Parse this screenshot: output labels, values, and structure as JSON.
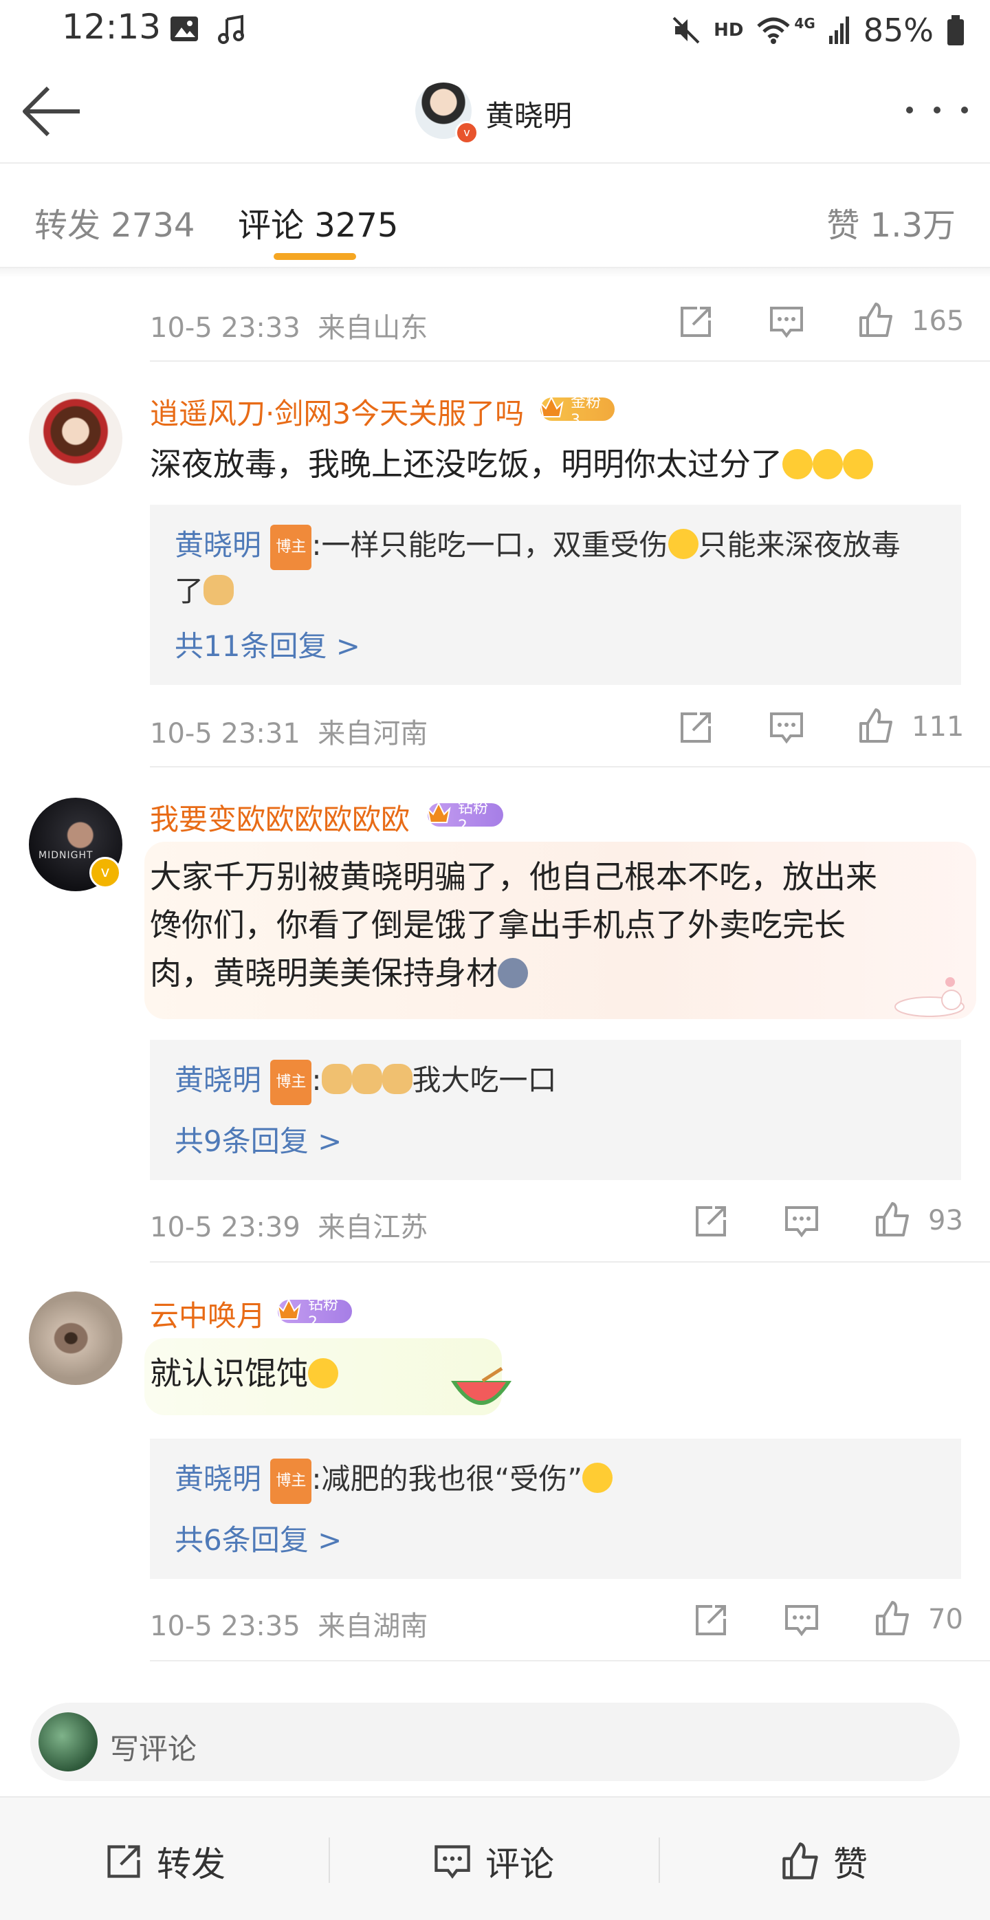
{
  "status_bar": {
    "time": "12:13",
    "network": "HD",
    "signal": "4G",
    "battery": "85%",
    "icons": [
      "gallery-icon",
      "music-icon",
      "mute-icon",
      "wifi-icon",
      "signal-icon",
      "battery-icon"
    ]
  },
  "header": {
    "title": "黄晓明",
    "back_icon": "back-arrow-icon",
    "more_icon": "more-icon"
  },
  "tabs": {
    "repost": "转发 2734",
    "comment": "评论 3275",
    "like": "赞 1.3万",
    "accent": "#f5a623"
  },
  "comments": [
    {
      "time": "10-5 23:33",
      "location": "来自山东",
      "likes": "165"
    },
    {
      "user": "逍遥风刀·剑网3今天关服了吗",
      "badge_label": "金粉3",
      "badge_level": "6",
      "text": "深夜放毒，我晚上还没吃饭，明明你太过分了",
      "reply": {
        "user": "黄晓明",
        "host_tag": "博主",
        "text_a": ":一样只能吃一口，双重受伤",
        "text_b": "只能来深夜放毒",
        "text_c": "了"
      },
      "more_replies": "共11条回复 >",
      "time": "10-5 23:31",
      "location": "来自河南",
      "likes": "111"
    },
    {
      "user": "我要变欧欧欧欧欧欧",
      "badge_label": "钻粉2",
      "badge_level": "6",
      "text_line1": "大家千万别被黄晓明骗了，他自己根本不吃，放出来",
      "text_line2": "馋你们，你看了倒是饿了拿出手机点了外卖吃完长",
      "text_line3": "肉，黄晓明美美保持身材",
      "avatar_text": "MIDNIGHT",
      "reply": {
        "user": "黄晓明",
        "host_tag": "博主",
        "text": "我大吃一口"
      },
      "more_replies": "共9条回复 >",
      "time": "10-5 23:39",
      "location": "来自江苏",
      "likes": "93"
    },
    {
      "user": "云中唤月",
      "badge_label": "钻粉2",
      "badge_level": "5",
      "text": "就认识馄饨",
      "reply": {
        "user": "黄晓明",
        "host_tag": "博主",
        "text": ":减肥的我也很“受伤”"
      },
      "more_replies": "共6条回复 >",
      "time": "10-5 23:35",
      "location": "来自湖南",
      "likes": "70"
    }
  ],
  "write_comment": {
    "placeholder": "写评论"
  },
  "bottom_bar": {
    "repost": "转发",
    "comment": "评论",
    "like": "赞"
  }
}
